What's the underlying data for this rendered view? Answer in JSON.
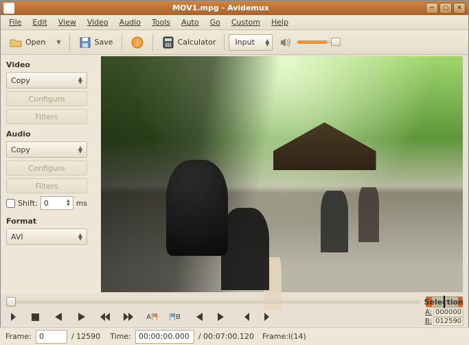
{
  "window": {
    "title": "MOV1.mpg - Avidemux"
  },
  "menu": {
    "file": "File",
    "edit": "Edit",
    "view": "View",
    "video": "Video",
    "audio": "Audio",
    "tools": "Tools",
    "auto": "Auto",
    "go": "Go",
    "custom": "Custom",
    "help": "Help"
  },
  "toolbar": {
    "open": "Open",
    "save": "Save",
    "calculator": "Calculator",
    "input_mode": "Input"
  },
  "video": {
    "label": "Video",
    "codec": "Copy",
    "configure": "Configure",
    "filters": "Filters"
  },
  "audio": {
    "label": "Audio",
    "codec": "Copy",
    "configure": "Configure",
    "filters": "Filters",
    "shift_label": "Shift:",
    "shift_value": "0",
    "shift_unit": "ms"
  },
  "format": {
    "label": "Format",
    "container": "AVI"
  },
  "selection": {
    "label": "Selection",
    "a_key": "A:",
    "a_val": "000000",
    "b_key": "B:",
    "b_val": "012590"
  },
  "status": {
    "frame_label": "Frame:",
    "frame_value": "0",
    "frame_total": "/ 12590",
    "time_label": "Time:",
    "time_value": "00:00:00.000",
    "duration": "/ 00:07:00.120",
    "frame_type": "Frame:I(14)"
  },
  "marks": {
    "a": "A",
    "b": "B"
  }
}
